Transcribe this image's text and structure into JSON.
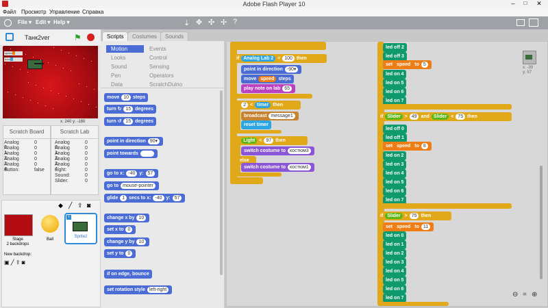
{
  "window": {
    "title": "Adobe Flash Player 10"
  },
  "menubar": {
    "items": [
      "Файл",
      "Просмотр",
      "Управление",
      "Справка"
    ]
  },
  "appbar": {
    "file": "File ▾",
    "edit": "Edit ▾",
    "help": "Help ▾"
  },
  "project": {
    "name": "Танк2ver",
    "coords": "x: 240  y: -180"
  },
  "stage_monitors": {
    "m1": "speed",
    "m2": "hour"
  },
  "tabs": {
    "scripts": "Scripts",
    "costumes": "Costumes",
    "sounds": "Sounds"
  },
  "categories": {
    "left": [
      "Motion",
      "Looks",
      "Sound",
      "Pen",
      "Data"
    ],
    "right": [
      "Events",
      "Control",
      "Sensing",
      "Operators",
      "ScratchDuino"
    ]
  },
  "boards": {
    "board1_title": "Scratch Board",
    "board2_title": "Scratch Lab",
    "board1": [
      [
        "Analog 0:",
        "0"
      ],
      [
        "Analog 1:",
        "0"
      ],
      [
        "Analog 2:",
        "0"
      ],
      [
        "Analog 3:",
        "0"
      ],
      [
        "Analog 4:",
        "0"
      ],
      [
        "Button:",
        "false"
      ]
    ],
    "board2": [
      [
        "Analog 0:",
        "0"
      ],
      [
        "Analog 1:",
        "0"
      ],
      [
        "Analog 2:",
        "0"
      ],
      [
        "Analog 3:",
        "0"
      ],
      [
        "Analog 4:",
        "0"
      ],
      [
        "Light:",
        "0"
      ],
      [
        "Sound:",
        "0"
      ],
      [
        "Slider:",
        "0"
      ]
    ]
  },
  "sprites": {
    "stage_label": "Stage",
    "stage_sub": "2 backdrops",
    "ball": "Ball",
    "sprite2": "Sprite2",
    "new_backdrop": "New backdrop:"
  },
  "palette": {
    "move": "move",
    "steps": "steps",
    "n10": "10",
    "turn": "turn",
    "degrees": "degrees",
    "n15": "15",
    "point_dir": "point in direction",
    "n90": "90▾",
    "point_towards": "point towards",
    "goto": "go to x:",
    "y": "y:",
    "n40": "-40",
    "n57": "57",
    "goto2": "go to",
    "mouse": "mouse-pointer",
    "glide": "glide",
    "n1": "1",
    "secs": "secs to x:",
    "changex": "change x by",
    "setx": "set x to",
    "n0": "0",
    "changey": "change y by",
    "sety": "set y to",
    "edge": "if on edge, bounce",
    "rot": "set rotation style",
    "leftright": "left-right"
  },
  "script1": {
    "if": "if",
    "analog": "Analog Lab 2",
    "eq": "=",
    "n100": "100",
    "then": "then",
    "pointdir": "point in direction",
    "d90": "-90▾",
    "move": "move",
    "speed": "speed",
    "steps": "steps",
    "note": "play note on lab",
    "n65": "65",
    "if2": "if",
    "n2": "2",
    "lt": "<",
    "timer": "timer",
    "then2": "then",
    "broadcast": "broadcast",
    "msg1": "message1",
    "reset": "reset timer",
    "if3": "if",
    "light": "Light",
    "n97": "97",
    "then3": "then",
    "switch": "switch costume to",
    "c3": "костюм3",
    "else": "else",
    "c1": "костюм1"
  },
  "script2": {
    "top": [
      "led off 2",
      "led off 3"
    ],
    "set": "set",
    "speed": "speed",
    "to": "to",
    "n5": "5",
    "leds1": [
      "led on 4",
      "led on 5",
      "led on 6",
      "led on 7"
    ],
    "if": "if",
    "slider": "Slider",
    "gt": ">",
    "n49": "49",
    "and": "and",
    "lt": "<",
    "n75": "75",
    "then": "then",
    "leds2": [
      "led off 0",
      "led off 1"
    ],
    "n8": "8",
    "leds3": [
      "led on 2",
      "led on 3",
      "led on 4",
      "led on 5",
      "led on 6",
      "led on 7"
    ],
    "n11": "11",
    "leds4": [
      "led on 0",
      "led on 1",
      "led on 2",
      "led on 3",
      "led on 4",
      "led on 5",
      "led on 6",
      "led on 7"
    ]
  },
  "sprite_info": {
    "x": "x: -39",
    "y": "y: 57"
  },
  "zoom": {
    "minus": "⊖",
    "eq": "=",
    "plus": "⊕"
  }
}
